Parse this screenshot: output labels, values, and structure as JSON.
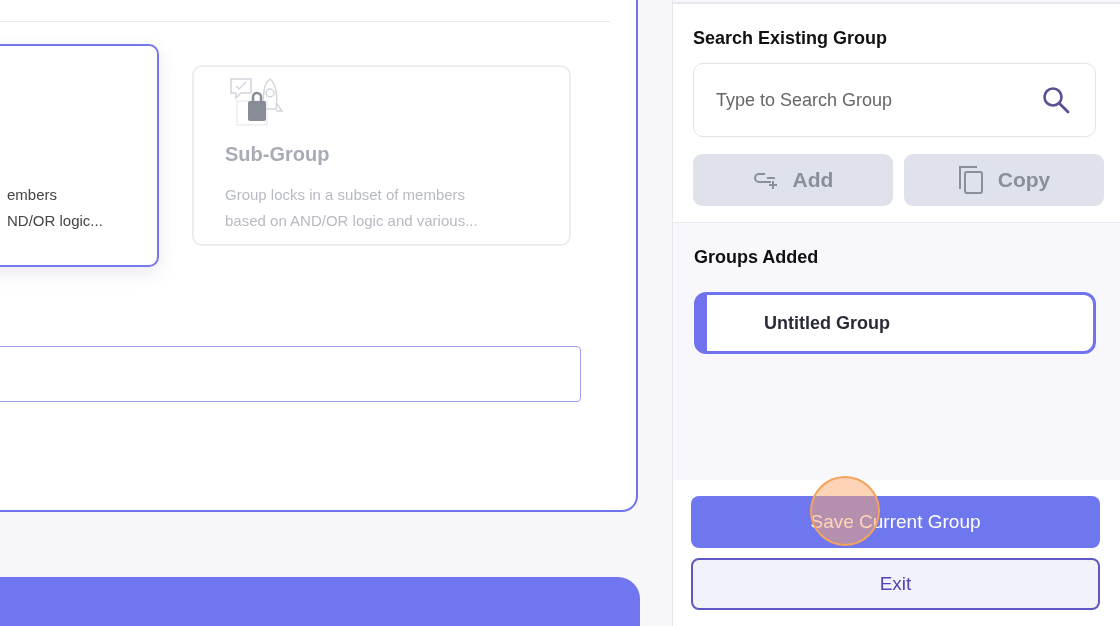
{
  "group_types": [
    {
      "description_lines": [
        "embers",
        "ND/OR logic..."
      ],
      "selected": true
    },
    {
      "title": "Sub-Group",
      "description_lines": [
        "Group locks in a subset of members",
        "based on AND/OR logic and various..."
      ],
      "selected": false
    }
  ],
  "search_panel": {
    "heading": "Search Existing Group",
    "placeholder": "Type to Search Group",
    "buttons": [
      {
        "kind": "add",
        "label": "Add",
        "disabled": true
      },
      {
        "kind": "copy",
        "label": "Copy",
        "disabled": true
      }
    ]
  },
  "groups_added": {
    "heading": "Groups Added",
    "items": [
      {
        "label": "Untitled Group",
        "selected": true
      }
    ]
  },
  "footer_buttons": [
    {
      "kind": "primary",
      "label": "Save Current Group"
    },
    {
      "kind": "secondary",
      "label": "Exit"
    }
  ]
}
